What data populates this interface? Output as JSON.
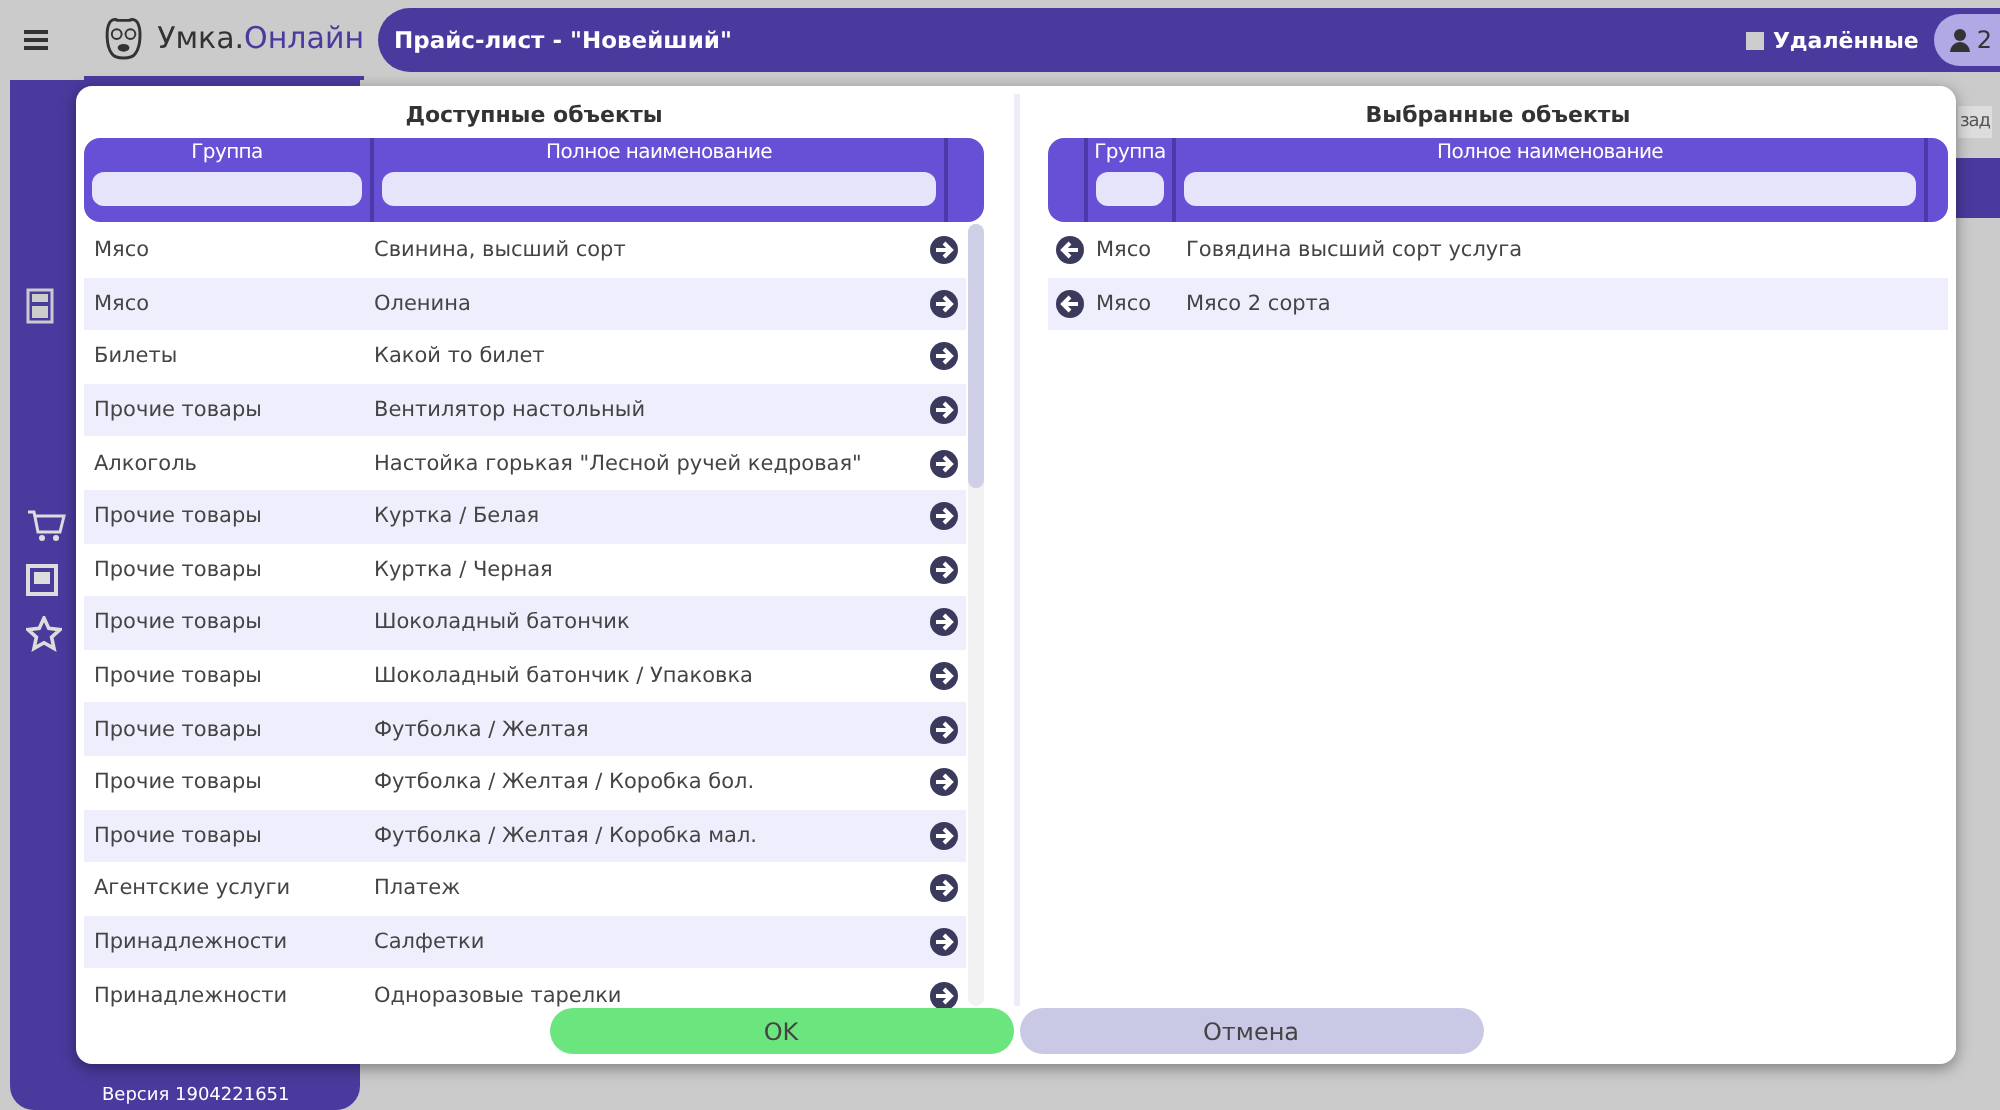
{
  "header": {
    "logo_prefix": "Умка.",
    "logo_suffix": "Онлайн",
    "title": "Прайс-лист - \"Новейший\"",
    "deleted_filter": {
      "label": "Удалённые",
      "checked": false
    },
    "users_count": "2"
  },
  "background": {
    "tab_fragment": "зад",
    "version": "Версия 1904221651"
  },
  "dialog": {
    "available": {
      "title": "Доступные объекты",
      "columns": [
        "Группа",
        "Полное наименование"
      ],
      "rows": [
        {
          "group": "Мясо",
          "name": "Свинина, высший сорт"
        },
        {
          "group": "Мясо",
          "name": "Оленина"
        },
        {
          "group": "Билеты",
          "name": "Какой то билет"
        },
        {
          "group": "Прочие товары",
          "name": "Вентилятор настольный"
        },
        {
          "group": "Алкоголь",
          "name": "Настойка горькая \"Лесной ручей кедровая\""
        },
        {
          "group": "Прочие товары",
          "name": "Куртка / Белая"
        },
        {
          "group": "Прочие товары",
          "name": "Куртка / Черная"
        },
        {
          "group": "Прочие товары",
          "name": "Шоколадный батончик"
        },
        {
          "group": "Прочие товары",
          "name": "Шоколадный батончик / Упаковка"
        },
        {
          "group": "Прочие товары",
          "name": "Футболка / Желтая"
        },
        {
          "group": "Прочие товары",
          "name": "Футболка / Желтая / Коробка бол."
        },
        {
          "group": "Прочие товары",
          "name": "Футболка / Желтая / Коробка мал."
        },
        {
          "group": "Агентские услуги",
          "name": "Платеж"
        },
        {
          "group": "Принадлежности",
          "name": "Салфетки"
        },
        {
          "group": "Принадлежности",
          "name": "Одноразовые тарелки"
        }
      ]
    },
    "selected": {
      "title": "Выбранные объекты",
      "columns": [
        "Группа",
        "Полное наименование"
      ],
      "rows": [
        {
          "group": "Мясо",
          "name": "Говядина высший сорт услуга"
        },
        {
          "group": "Мясо",
          "name": "Мясо 2 сорта"
        }
      ]
    },
    "buttons": [
      {
        "label": "OK",
        "kind": "primary"
      },
      {
        "label": "Отмена",
        "kind": "secondary"
      }
    ]
  }
}
